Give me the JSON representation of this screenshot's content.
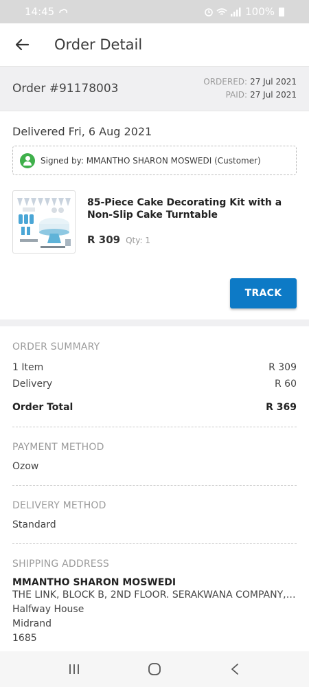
{
  "status_bar": {
    "time": "14:45",
    "battery": "100%"
  },
  "app_bar": {
    "title": "Order Detail"
  },
  "order": {
    "number": "Order #91178003",
    "ordered_label": "ORDERED:",
    "ordered_date": "27 Jul 2021",
    "paid_label": "PAID:",
    "paid_date": "27 Jul 2021"
  },
  "delivery": {
    "status": "Delivered Fri, 6 Aug 2021",
    "signed_by": "Signed by: MMANTHO SHARON MOSWEDI (Customer)"
  },
  "product": {
    "name": "85-Piece Cake Decorating Kit with a Non-Slip Cake Turntable",
    "price": "R 309",
    "qty": "Qty: 1"
  },
  "track_label": "TRACK",
  "summary": {
    "heading": "ORDER SUMMARY",
    "items_label": "1 Item",
    "items_value": "R 309",
    "delivery_label": "Delivery",
    "delivery_value": "R 60",
    "total_label": "Order Total",
    "total_value": "R 369"
  },
  "payment": {
    "heading": "PAYMENT METHOD",
    "value": "Ozow"
  },
  "delivery_method": {
    "heading": "DELIVERY METHOD",
    "value": "Standard"
  },
  "shipping": {
    "heading": "SHIPPING ADDRESS",
    "name": "MMANTHO SHARON MOSWEDI",
    "line1": "THE LINK, BLOCK B, 2ND FLOOR. SERAKWANA COMPANY, 6...",
    "line2": "Halfway House",
    "line3": "Midrand",
    "line4": "1685"
  },
  "colors": {
    "accent": "#0d7ac6",
    "signed_icon": "#3fb04b",
    "section_bg": "#f0f0f2"
  },
  "icons": [
    "back-arrow-icon",
    "user-check-icon",
    "recents-icon",
    "home-icon",
    "back-nav-icon"
  ]
}
